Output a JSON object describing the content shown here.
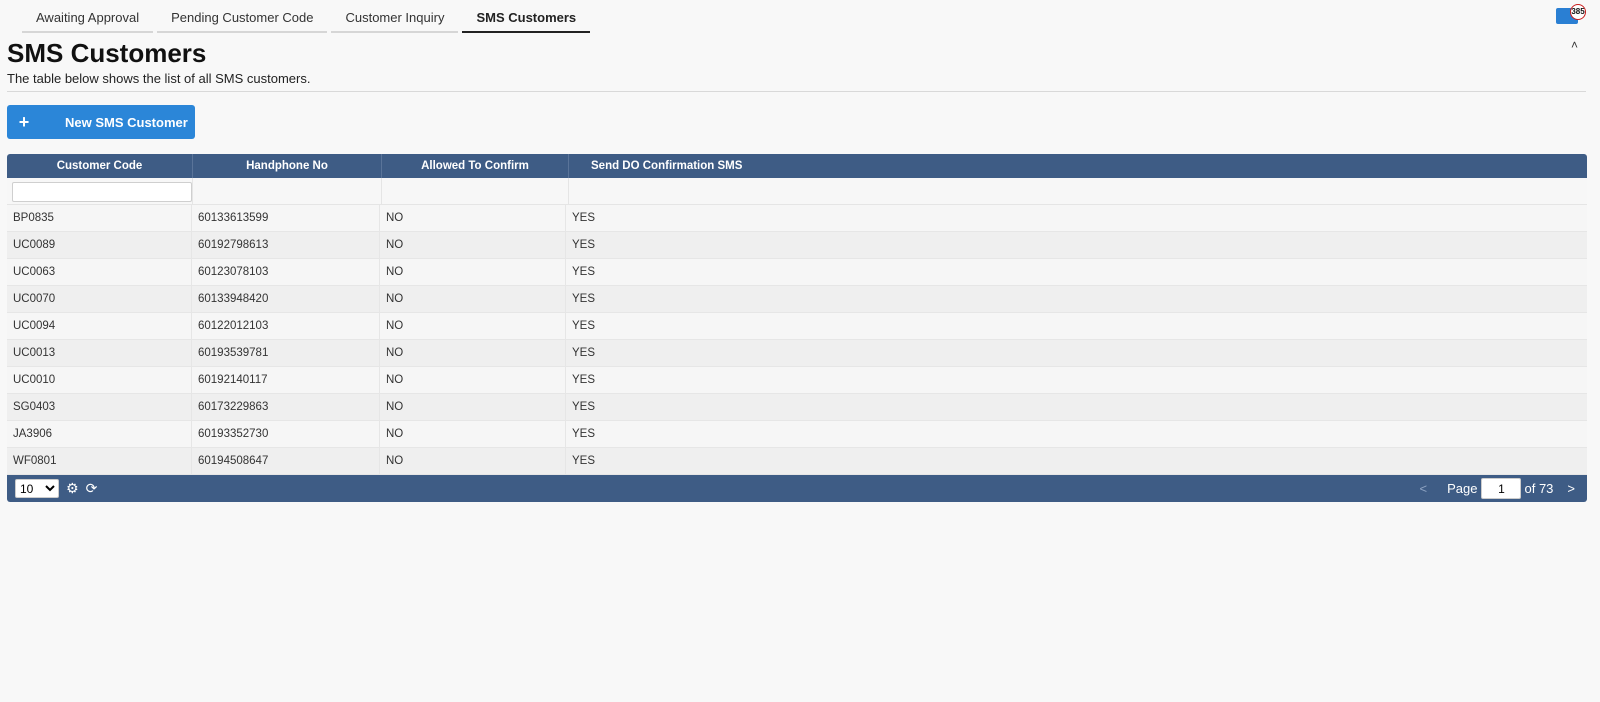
{
  "tabs": [
    {
      "label": "Awaiting Approval"
    },
    {
      "label": "Pending Customer Code"
    },
    {
      "label": "Customer Inquiry"
    },
    {
      "label": "SMS Customers"
    }
  ],
  "notifications": {
    "count": "385"
  },
  "page": {
    "title": "SMS Customers",
    "subtitle": "The table below shows the list of all SMS customers."
  },
  "new_button": {
    "label": "New SMS Customer"
  },
  "grid": {
    "columns": [
      "Customer Code",
      "Handphone No",
      "Allowed To Confirm",
      "Send DO Confirmation SMS"
    ],
    "filter_value": "",
    "rows": [
      [
        "BP0835",
        "60133613599",
        "NO",
        "YES"
      ],
      [
        "UC0089",
        "60192798613",
        "NO",
        "YES"
      ],
      [
        "UC0063",
        "60123078103",
        "NO",
        "YES"
      ],
      [
        "UC0070",
        "60133948420",
        "NO",
        "YES"
      ],
      [
        "UC0094",
        "60122012103",
        "NO",
        "YES"
      ],
      [
        "UC0013",
        "60193539781",
        "NO",
        "YES"
      ],
      [
        "UC0010",
        "60192140117",
        "NO",
        "YES"
      ],
      [
        "SG0403",
        "60173229863",
        "NO",
        "YES"
      ],
      [
        "JA3906",
        "60193352730",
        "NO",
        "YES"
      ],
      [
        "WF0801",
        "60194508647",
        "NO",
        "YES"
      ]
    ]
  },
  "pager": {
    "page_size": "10",
    "page_label": "Page",
    "current_page": "1",
    "of_label": "of 73",
    "prev": "<",
    "next": ">"
  }
}
